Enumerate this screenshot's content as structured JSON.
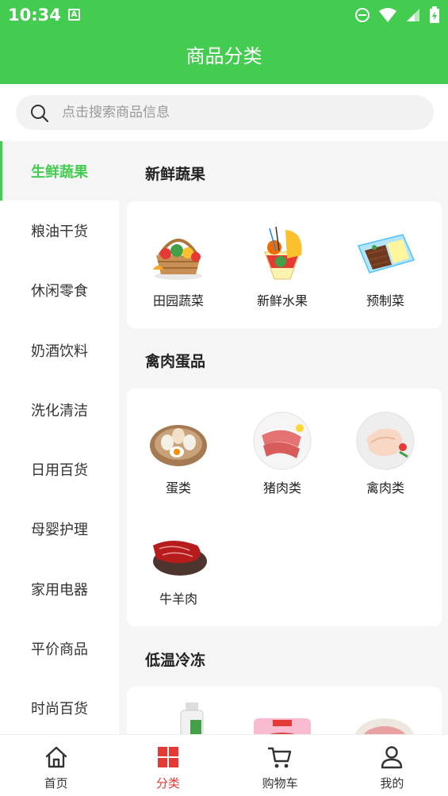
{
  "status_bar": {
    "time": "10:34",
    "notification_glyph": "A"
  },
  "header": {
    "title": "商品分类"
  },
  "search": {
    "placeholder": "点击搜索商品信息"
  },
  "sidebar": {
    "items": [
      {
        "label": "生鲜蔬果",
        "active": true
      },
      {
        "label": "粮油干货"
      },
      {
        "label": "休闲零食"
      },
      {
        "label": "奶酒饮料"
      },
      {
        "label": "洗化清洁"
      },
      {
        "label": "日用百货"
      },
      {
        "label": "母婴护理"
      },
      {
        "label": "家用电器"
      },
      {
        "label": "平价商品"
      },
      {
        "label": "时尚百货"
      }
    ]
  },
  "sections": [
    {
      "title": "新鲜蔬果",
      "items": [
        {
          "label": "田园蔬菜"
        },
        {
          "label": "新鲜水果"
        },
        {
          "label": "预制菜"
        }
      ]
    },
    {
      "title": "禽肉蛋品",
      "items": [
        {
          "label": "蛋类"
        },
        {
          "label": "猪肉类"
        },
        {
          "label": "禽肉类"
        },
        {
          "label": "牛羊肉"
        }
      ]
    },
    {
      "title": "低温冷冻",
      "items": []
    }
  ],
  "tabbar": {
    "items": [
      {
        "label": "首页",
        "icon": "home-icon"
      },
      {
        "label": "分类",
        "icon": "grid-icon",
        "active": true
      },
      {
        "label": "购物车",
        "icon": "cart-icon"
      },
      {
        "label": "我的",
        "icon": "user-icon"
      }
    ]
  },
  "colors": {
    "brand": "#44cc50",
    "tab_active": "#e53935"
  }
}
